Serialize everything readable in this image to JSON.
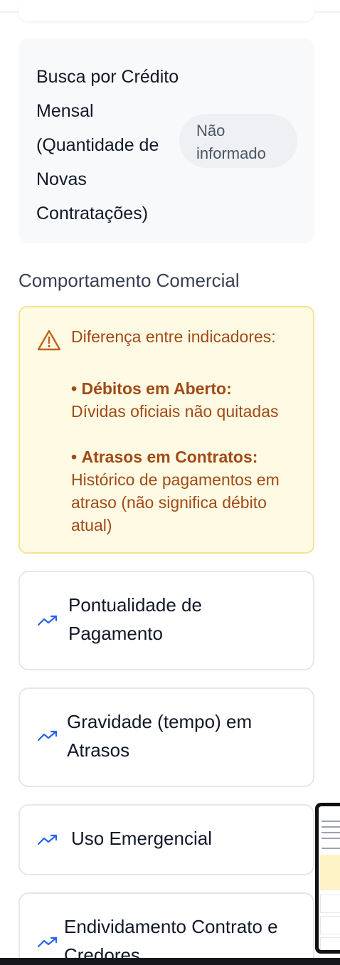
{
  "info": {
    "label": "Busca por Crédito Mensal (Quantidade de Novas Contratações)",
    "value": "Não informado"
  },
  "section_title": "Comportamento Comercial",
  "warning": {
    "title": "Diferença entre indicadores:",
    "items": [
      {
        "bullet": "•",
        "term": "Débitos em Aberto:",
        "desc": "Dívidas oficiais não quitadas"
      },
      {
        "bullet": "•",
        "term": "Atrasos em Contratos:",
        "desc": "Histórico de pagamentos em atraso (não significa débito atual)"
      }
    ],
    "icon": "warning-triangle-icon"
  },
  "cards": [
    {
      "title": "Pontualidade de Pagamento",
      "icon": "trending-up-icon"
    },
    {
      "title": "Gravidade (tempo) em Atrasos",
      "icon": "trending-up-icon"
    },
    {
      "title": "Uso Emergencial",
      "icon": "trending-up-icon"
    },
    {
      "title": "Endividamento Contrato e Credores",
      "icon": "trending-up-icon"
    }
  ],
  "colors": {
    "accent_icon": "#2563eb",
    "warning_text": "#a14a15",
    "warning_bg": "#fefae3",
    "warning_border": "#f6e391"
  }
}
